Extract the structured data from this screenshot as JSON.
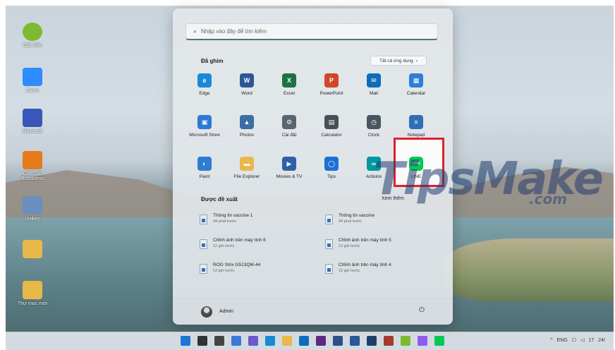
{
  "desktop": {
    "icons": [
      {
        "label": "Cốc Cốc",
        "color": "#7fb92f"
      },
      {
        "label": "Zoom",
        "color": "#2d8cff"
      },
      {
        "label": "Microsoft",
        "color": "#3a56b8"
      },
      {
        "label": "Cốc Cốc Bussiness",
        "color": "#e57a1c"
      },
      {
        "label": "Unikey",
        "color": "#6a8fbf"
      },
      {
        "label": "",
        "color": "#e8b84a"
      },
      {
        "label": "Thư mục mới",
        "color": "#e8b84a"
      }
    ]
  },
  "start_menu": {
    "search_placeholder": "Nhập vào đây để tìm kiếm",
    "pinned_title": "Đã ghim",
    "all_apps_label": "Tất cả ứng dụng",
    "all_apps_chevron": "›",
    "pinned_apps": [
      {
        "label": "Edge",
        "color": "#1a8ad4",
        "glyph": "e"
      },
      {
        "label": "Word",
        "color": "#2b5797",
        "glyph": "W"
      },
      {
        "label": "Excel",
        "color": "#1e7145",
        "glyph": "X"
      },
      {
        "label": "PowerPoint",
        "color": "#d24726",
        "glyph": "P"
      },
      {
        "label": "Mail",
        "color": "#0f6cbd",
        "glyph": "✉"
      },
      {
        "label": "Calendar",
        "color": "#2f80d1",
        "glyph": "▦"
      },
      {
        "label": "Microsoft Store",
        "color": "#2b7bd4",
        "glyph": "▣"
      },
      {
        "label": "Photos",
        "color": "#3a6ea5",
        "glyph": "▲"
      },
      {
        "label": "Cài đặt",
        "color": "#5a6570",
        "glyph": "⚙"
      },
      {
        "label": "Calculator",
        "color": "#4a4f55",
        "glyph": "▤"
      },
      {
        "label": "Clock",
        "color": "#4a5560",
        "glyph": "◷"
      },
      {
        "label": "Notepad",
        "color": "#2f6fb5",
        "glyph": "≡"
      },
      {
        "label": "Paint",
        "color": "#2d7dd2",
        "glyph": "◐"
      },
      {
        "label": "File Explorer",
        "color": "#e8b84a",
        "glyph": "▬"
      },
      {
        "label": "Movies & TV",
        "color": "#2f5fa8",
        "glyph": "▶"
      },
      {
        "label": "Tips",
        "color": "#1d6fd6",
        "glyph": "◯"
      },
      {
        "label": "Arduino",
        "color": "#00979d",
        "glyph": "∞"
      },
      {
        "label": "LINE",
        "color": "#06c755",
        "glyph": "LINE"
      }
    ],
    "recommended_title": "Được đề xuất",
    "more_label": "Xem thêm",
    "recommended": [
      {
        "name": "Thông tin vaccine 1",
        "time": "44 phút trước"
      },
      {
        "name": "Thông tin vaccine",
        "time": "44 phút trước"
      },
      {
        "name": "Chỉnh ảnh trên máy tính 6",
        "time": "12 giờ trước"
      },
      {
        "name": "Chỉnh ảnh trên máy tính 5",
        "time": "12 giờ trước"
      },
      {
        "name": "ROG Strix G513QM-44",
        "time": "12 giờ trước"
      },
      {
        "name": "Chỉnh ảnh trên máy tính 4",
        "time": "12 giờ trước"
      }
    ],
    "user_name": "Admin",
    "power_glyph": "⏻"
  },
  "watermark": {
    "main": "TipsMake",
    "suffix": ".com"
  },
  "taskbar": {
    "icons": [
      {
        "name": "start-button",
        "color": "#1f74d8"
      },
      {
        "name": "search-icon",
        "color": "#333"
      },
      {
        "name": "task-view-icon",
        "color": "#444"
      },
      {
        "name": "widgets-icon",
        "color": "#3b78d8"
      },
      {
        "name": "chat-icon",
        "color": "#6a5acd"
      },
      {
        "name": "edge-icon",
        "color": "#1a8ad4"
      },
      {
        "name": "file-explorer-icon",
        "color": "#e8b84a"
      },
      {
        "name": "mail-icon",
        "color": "#0f6cbd"
      },
      {
        "name": "premiere-icon",
        "color": "#5a2a80"
      },
      {
        "name": "app-icon",
        "color": "#2b4f8a"
      },
      {
        "name": "word-icon",
        "color": "#2b5797"
      },
      {
        "name": "photoshop-icon",
        "color": "#1f3f6a"
      },
      {
        "name": "onenote-icon",
        "color": "#a33a2a"
      },
      {
        "name": "cococ-icon",
        "color": "#7fb92f"
      },
      {
        "name": "messenger-icon",
        "color": "#8e5cf0"
      },
      {
        "name": "line-icon",
        "color": "#06c755"
      }
    ],
    "tray": {
      "chevron": "^",
      "lang": "ENG",
      "time": "17",
      "date": "24/"
    }
  }
}
